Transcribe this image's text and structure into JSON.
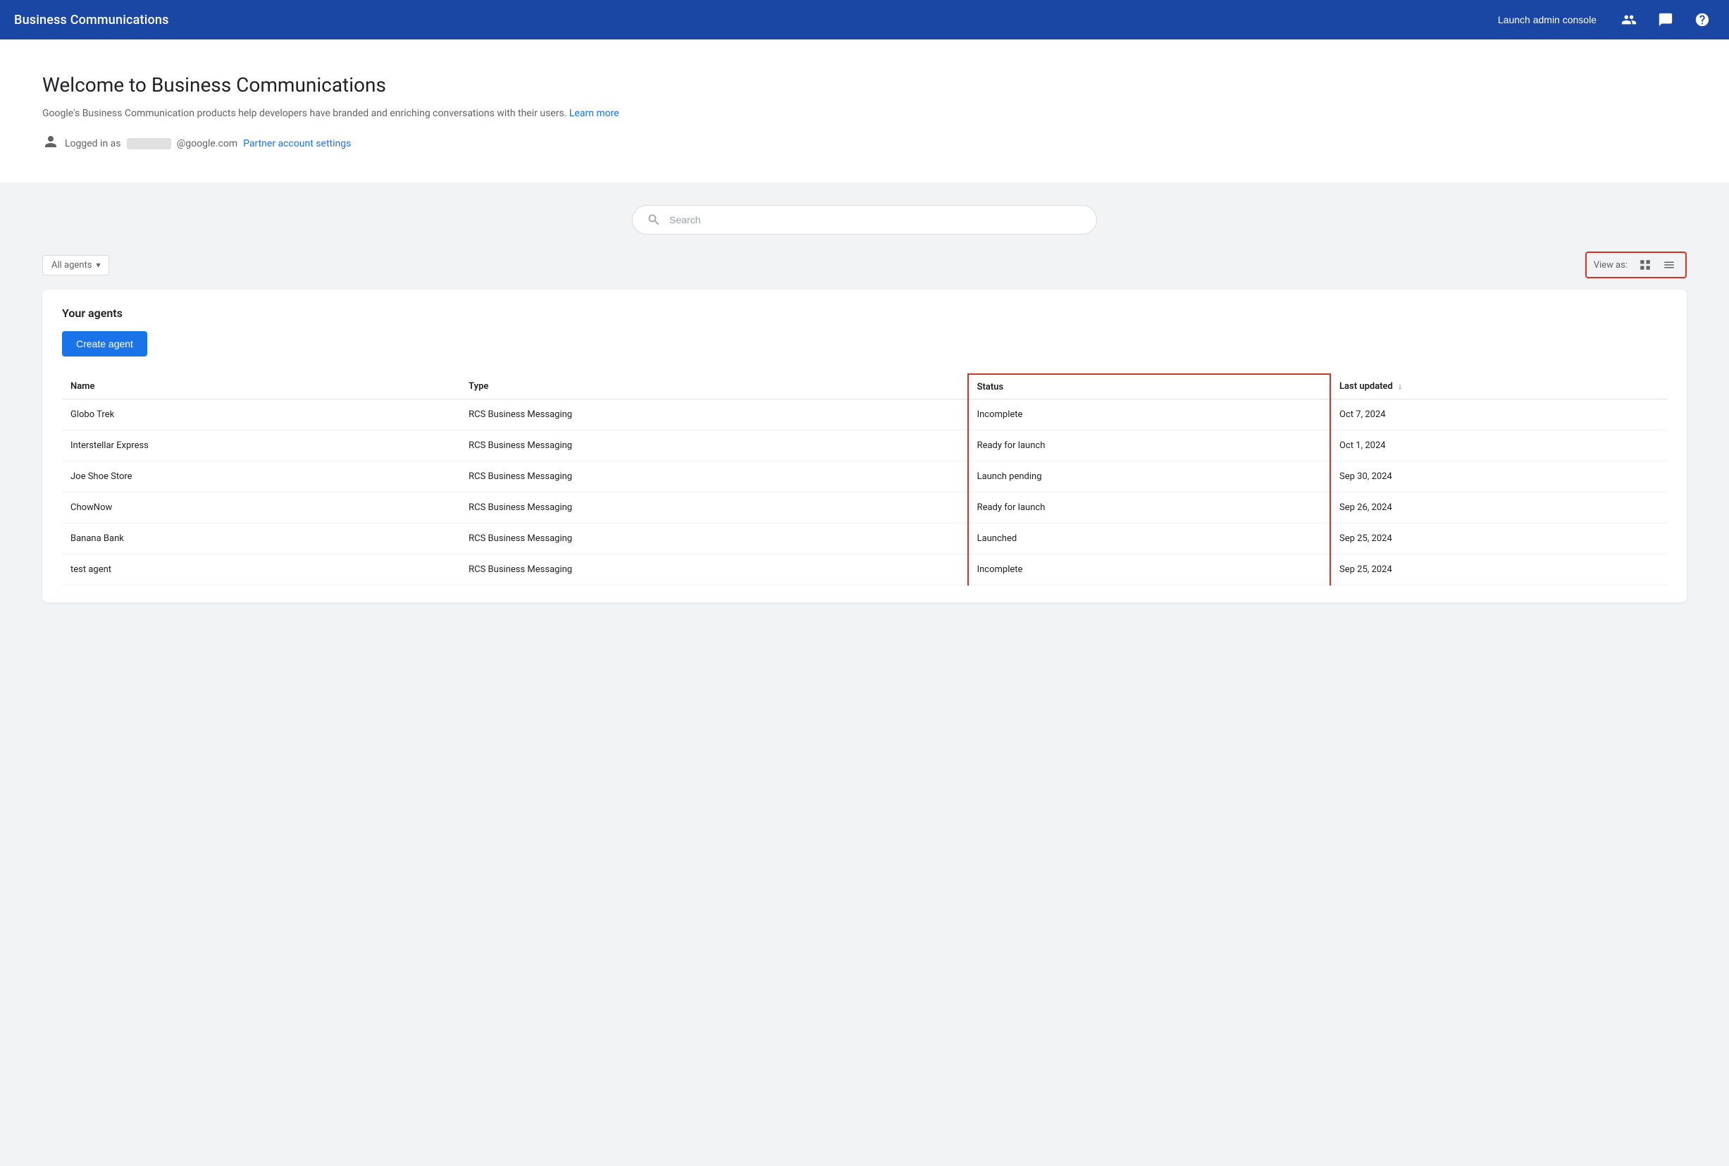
{
  "header": {
    "title": "Business Communications",
    "launch_admin_console": "Launch admin console",
    "icons": {
      "people": "👥",
      "chat": "💬",
      "help": "❓"
    }
  },
  "welcome": {
    "title": "Welcome to Business Communications",
    "description": "Google's Business Communication products help developers have branded and enriching conversations with their users.",
    "learn_more_label": "Learn more",
    "logged_in_prefix": "Logged in as",
    "email_domain": "@google.com",
    "partner_settings_label": "Partner account settings"
  },
  "search": {
    "placeholder": "Search"
  },
  "toolbar": {
    "filter_label": "All agents",
    "view_as_label": "View as:"
  },
  "agents": {
    "section_title": "Your agents",
    "create_button": "Create agent",
    "table": {
      "columns": [
        {
          "key": "name",
          "label": "Name"
        },
        {
          "key": "type",
          "label": "Type"
        },
        {
          "key": "status",
          "label": "Status",
          "highlighted": true
        },
        {
          "key": "last_updated",
          "label": "Last updated",
          "sortable": true
        }
      ],
      "rows": [
        {
          "name": "Globo Trek",
          "type": "RCS Business Messaging",
          "status": "Incomplete",
          "last_updated": "Oct 7, 2024"
        },
        {
          "name": "Interstellar Express",
          "type": "RCS Business Messaging",
          "status": "Ready for launch",
          "last_updated": "Oct 1, 2024"
        },
        {
          "name": "Joe Shoe Store",
          "type": "RCS Business Messaging",
          "status": "Launch pending",
          "last_updated": "Sep 30, 2024"
        },
        {
          "name": "ChowNow",
          "type": "RCS Business Messaging",
          "status": "Ready for launch",
          "last_updated": "Sep 26, 2024"
        },
        {
          "name": "Banana Bank",
          "type": "RCS Business Messaging",
          "status": "Launched",
          "last_updated": "Sep 25, 2024"
        },
        {
          "name": "test agent",
          "type": "RCS Business Messaging",
          "status": "Incomplete",
          "last_updated": "Sep 25, 2024"
        }
      ]
    }
  }
}
